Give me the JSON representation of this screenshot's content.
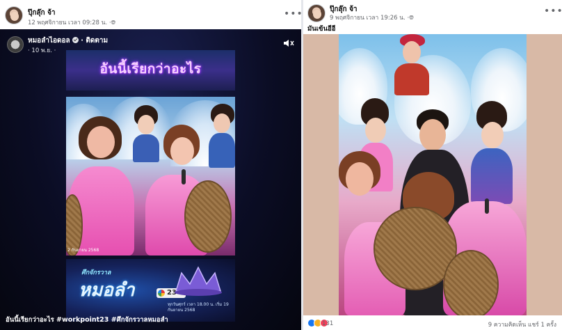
{
  "left_post": {
    "author": "ปุ๊กลุ๊ก จ้า",
    "timestamp": "12 พฤศจิกายน เวลา 09:28 น.",
    "privacy_icon": "globe-icon",
    "more_icon": "more-options-icon",
    "video": {
      "channel_name": "หมอลำไอดอล",
      "follow_label": "ติดตาม",
      "date": "10 พ.ย.",
      "title_overlay": "อันนี้เรียกว่าอะไร",
      "frame_stamp": "2 กันยายน 2568",
      "show_subtitle": "ศึกจักรวาล",
      "show_title": "หมอลำ",
      "channel_number": "23",
      "air_info": "ทุกวันศุกร์ เวลา 18.00 น. เริ่ม 19 กันยายน 2568",
      "caption": "อันนี้เรียกว่าอะไร #workpoint23 #ศึกจักรวาลหมอลำ"
    }
  },
  "right_post": {
    "author": "ปุ๊กลุ๊ก จ้า",
    "timestamp": "9 พฤศจิกายน เวลา 19:26 น.",
    "privacy_icon": "globe-icon",
    "more_icon": "more-options-icon",
    "text": "มันเข้นอีอี",
    "reactions": {
      "icons": [
        "like-icon",
        "haha-icon",
        "love-icon"
      ],
      "count": "131"
    },
    "stats": "9 ความคิดเห็น  แชร์ 1 ครั้ง"
  },
  "colors": {
    "facebook_blue": "#1877f2",
    "secondary_text": "#65676b",
    "video_bg": "#0d0d1e"
  }
}
